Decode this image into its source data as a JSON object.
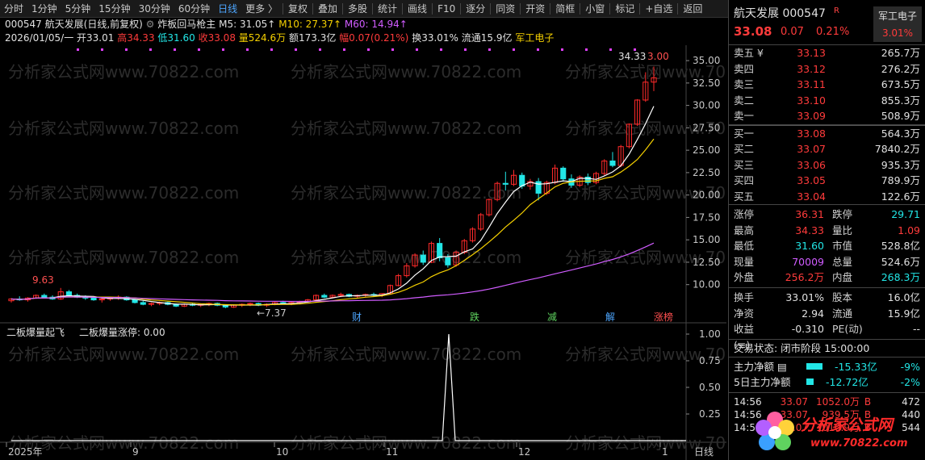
{
  "toolbar": {
    "periods": [
      "分时",
      "1分钟",
      "5分钟",
      "15分钟",
      "30分钟",
      "60分钟",
      "日线",
      "更多 〉"
    ],
    "active_period": "日线",
    "tools": [
      "复权",
      "叠加",
      "多股",
      "统计",
      "画线",
      "F10",
      "逐分",
      "同资",
      "开资",
      "简框",
      "小窗",
      "标记",
      "+自选",
      "返回"
    ]
  },
  "header": {
    "line1": {
      "code": "000547",
      "name": "航天发展",
      "mode": "(日线,前复权)",
      "indicator": "炸板回马枪主",
      "ma5": "M5: 31.05↑",
      "ma10": "M10: 27.37↑",
      "ma60": "M60: 14.94↑"
    },
    "line2": {
      "date_open": "2026/01/05/一 开33.01",
      "high": "高34.33",
      "low": "低31.60",
      "close": "收33.08",
      "vol": "量524.6万",
      "amount": "额173.3亿",
      "range": "幅0.07(0.21%)",
      "turnover": "换33.01%",
      "float": "流通15.9亿",
      "sector": "军工电子"
    }
  },
  "main_chart": {
    "y_ticks": [
      "35.00",
      "32.50",
      "30.00",
      "27.50",
      "25.00",
      "22.50",
      "20.00",
      "17.50",
      "15.00",
      "12.50",
      "10.00"
    ],
    "label_high": "9.63",
    "label_low": "←7.37",
    "label_top": "34.33",
    "label_top2": "3.00",
    "markers": [
      "财",
      "跌",
      "减",
      "解",
      "涨榜"
    ],
    "watermark": "分析家公式网www.70822.com"
  },
  "sub_chart": {
    "title": "二板爆量起飞",
    "value_label": "二板爆量涨停: 0.00",
    "y_ticks": [
      "1.00",
      "0.75",
      "0.50",
      "0.25"
    ]
  },
  "x_axis": {
    "labels": [
      "2025年",
      "9",
      "10",
      "11",
      "12",
      "1"
    ],
    "period": "日线"
  },
  "right": {
    "name": "航天发展",
    "code": "000547",
    "flag": "R",
    "price": "33.08",
    "change": "0.07",
    "pct": "0.21%",
    "sector": "军工电子",
    "sector_pct": "3.01%",
    "asks": [
      {
        "label": "卖五 ¥",
        "price": "33.13",
        "vol": "265.7万"
      },
      {
        "label": "卖四",
        "price": "33.12",
        "vol": "276.2万"
      },
      {
        "label": "卖三",
        "price": "33.11",
        "vol": "673.5万"
      },
      {
        "label": "卖二",
        "price": "33.10",
        "vol": "855.3万"
      },
      {
        "label": "卖一",
        "price": "33.09",
        "vol": "508.9万"
      }
    ],
    "bids": [
      {
        "label": "买一",
        "price": "33.08",
        "vol": "564.3万"
      },
      {
        "label": "买二",
        "price": "33.07",
        "vol": "7840.2万"
      },
      {
        "label": "买三",
        "price": "33.06",
        "vol": "935.3万"
      },
      {
        "label": "买四",
        "price": "33.05",
        "vol": "789.9万"
      },
      {
        "label": "买五",
        "price": "33.04",
        "vol": "122.6万"
      }
    ],
    "stats1": [
      {
        "l": "涨停",
        "v": "36.31",
        "c": "red",
        "l2": "跌停",
        "v2": "29.71",
        "c2": "cyan"
      },
      {
        "l": "最高",
        "v": "34.33",
        "c": "red",
        "l2": "量比",
        "v2": "1.09",
        "c2": "red"
      },
      {
        "l": "最低",
        "v": "31.60",
        "c": "cyan",
        "l2": "市值",
        "v2": "528.8亿",
        "c2": "white"
      },
      {
        "l": "现量",
        "v": "70009",
        "c": "purple",
        "l2": "总量",
        "v2": "524.6万",
        "c2": "white"
      },
      {
        "l": "外盘",
        "v": "256.2万",
        "c": "red",
        "l2": "内盘",
        "v2": "268.3万",
        "c2": "cyan"
      }
    ],
    "stats2": [
      {
        "l": "换手",
        "v": "33.01%",
        "c": "white",
        "l2": "股本",
        "v2": "16.0亿",
        "c2": "white"
      },
      {
        "l": "净资",
        "v": "2.94",
        "c": "white",
        "l2": "流通",
        "v2": "15.9亿",
        "c2": "white"
      },
      {
        "l": "收益(≡)",
        "v": "-0.310",
        "c": "white",
        "l2": "PE(动)",
        "v2": "--",
        "c2": "white"
      }
    ],
    "status": "交易状态: 闭市阶段 15:00:00",
    "flows": [
      {
        "label": "主力净额 ▤",
        "value": "-15.33亿",
        "pct": "-9%",
        "bar": 0.9
      },
      {
        "label": "5日主力净额",
        "value": "-12.72亿",
        "pct": "-2%",
        "bar": 0.4
      }
    ],
    "ticks": [
      {
        "t": "14:56",
        "p": "33.07",
        "v": "1052.0万",
        "s": "B",
        "n": "472"
      },
      {
        "t": "14:56",
        "p": "33.07",
        "v": "939.5万",
        "s": "B",
        "n": "440"
      },
      {
        "t": "14:56",
        "p": "33.07",
        "v": "1010.9万",
        "s": "B",
        "n": "544"
      }
    ],
    "logo": {
      "t1": "分析家公式网",
      "t2": "www.70822.com"
    }
  },
  "chart_data": {
    "type": "candlestick",
    "title": "航天发展 (日线,前复权)",
    "ylim": [
      7,
      36
    ],
    "x_labels": [
      "2025年",
      "9",
      "10",
      "11",
      "12",
      "1"
    ],
    "candles": [
      [
        8.2,
        8.5,
        8.0,
        8.4
      ],
      [
        8.4,
        8.7,
        8.2,
        8.3
      ],
      [
        8.3,
        8.6,
        8.1,
        8.5
      ],
      [
        8.5,
        8.9,
        8.4,
        8.8
      ],
      [
        8.8,
        9.0,
        8.5,
        8.6
      ],
      [
        8.6,
        8.8,
        8.3,
        8.4
      ],
      [
        8.4,
        9.63,
        8.3,
        9.2
      ],
      [
        9.2,
        9.4,
        8.7,
        8.8
      ],
      [
        8.8,
        9.0,
        8.5,
        8.6
      ],
      [
        8.6,
        8.8,
        8.3,
        8.5
      ],
      [
        8.5,
        8.7,
        8.2,
        8.3
      ],
      [
        8.3,
        8.5,
        8.0,
        8.4
      ],
      [
        8.4,
        8.6,
        8.2,
        8.5
      ],
      [
        8.5,
        8.8,
        8.3,
        8.6
      ],
      [
        8.6,
        8.7,
        8.2,
        8.3
      ],
      [
        8.3,
        8.4,
        7.9,
        8.0
      ],
      [
        8.0,
        8.2,
        7.7,
        7.8
      ],
      [
        7.8,
        8.0,
        7.6,
        7.9
      ],
      [
        7.9,
        8.1,
        7.7,
        8.0
      ],
      [
        8.0,
        8.1,
        7.7,
        7.8
      ],
      [
        7.8,
        7.9,
        7.5,
        7.6
      ],
      [
        7.6,
        7.9,
        7.5,
        7.8
      ],
      [
        7.8,
        8.0,
        7.6,
        7.7
      ],
      [
        7.7,
        7.9,
        7.5,
        7.8
      ],
      [
        7.8,
        8.0,
        7.6,
        7.9
      ],
      [
        7.9,
        8.0,
        7.6,
        7.7
      ],
      [
        7.7,
        7.8,
        7.37,
        7.5
      ],
      [
        7.5,
        7.8,
        7.4,
        7.7
      ],
      [
        7.7,
        7.9,
        7.5,
        7.8
      ],
      [
        7.8,
        8.0,
        7.6,
        7.9
      ],
      [
        7.9,
        8.0,
        7.6,
        7.7
      ],
      [
        7.7,
        7.9,
        7.5,
        7.8
      ],
      [
        7.8,
        8.1,
        7.7,
        8.0
      ],
      [
        8.0,
        8.2,
        7.8,
        7.9
      ],
      [
        7.9,
        8.1,
        7.7,
        8.0
      ],
      [
        8.0,
        8.2,
        7.8,
        8.1
      ],
      [
        8.1,
        8.4,
        8.0,
        8.3
      ],
      [
        8.3,
        8.9,
        8.2,
        8.8
      ],
      [
        8.8,
        9.0,
        8.5,
        8.6
      ],
      [
        8.6,
        8.9,
        8.5,
        8.8
      ],
      [
        8.8,
        9.1,
        8.6,
        8.9
      ],
      [
        8.9,
        9.0,
        8.6,
        8.7
      ],
      [
        8.7,
        8.9,
        8.5,
        8.8
      ],
      [
        8.8,
        9.0,
        8.6,
        8.9
      ],
      [
        8.9,
        9.1,
        8.7,
        8.8
      ],
      [
        8.8,
        9.0,
        8.6,
        9.0
      ],
      [
        9.0,
        10.0,
        8.9,
        9.9
      ],
      [
        9.9,
        11.2,
        9.8,
        11.0
      ],
      [
        11.0,
        12.4,
        10.8,
        12.1
      ],
      [
        12.1,
        13.5,
        11.9,
        13.3
      ],
      [
        13.3,
        13.8,
        12.2,
        12.5
      ],
      [
        12.5,
        14.8,
        12.4,
        14.6
      ],
      [
        14.6,
        15.2,
        12.6,
        13.0
      ],
      [
        13.0,
        13.4,
        11.9,
        12.2
      ],
      [
        12.2,
        13.8,
        12.0,
        13.6
      ],
      [
        13.6,
        15.1,
        13.4,
        14.9
      ],
      [
        14.9,
        16.4,
        14.7,
        16.2
      ],
      [
        16.2,
        18.0,
        16.0,
        17.8
      ],
      [
        17.8,
        19.6,
        17.6,
        19.5
      ],
      [
        19.5,
        21.5,
        19.3,
        21.3
      ],
      [
        21.3,
        22.6,
        20.5,
        21.2
      ],
      [
        21.2,
        22.8,
        21.0,
        22.2
      ],
      [
        22.2,
        22.5,
        20.7,
        21.0
      ],
      [
        21.0,
        21.8,
        20.6,
        21.5
      ],
      [
        21.5,
        21.9,
        19.4,
        20.2
      ],
      [
        20.2,
        21.6,
        20.0,
        21.4
      ],
      [
        21.4,
        23.4,
        21.2,
        23.0
      ],
      [
        23.0,
        23.2,
        21.5,
        21.8
      ],
      [
        21.8,
        22.3,
        20.8,
        21.1
      ],
      [
        21.1,
        22.2,
        20.9,
        22.0
      ],
      [
        22.0,
        22.4,
        21.1,
        21.4
      ],
      [
        21.4,
        22.6,
        21.2,
        22.4
      ],
      [
        22.4,
        24.0,
        22.2,
        23.8
      ],
      [
        23.8,
        24.8,
        23.1,
        23.3
      ],
      [
        23.3,
        25.6,
        23.1,
        25.4
      ],
      [
        25.4,
        28.0,
        25.2,
        27.9
      ],
      [
        27.9,
        30.7,
        27.7,
        30.6
      ],
      [
        30.6,
        33.7,
        30.4,
        32.6
      ],
      [
        32.6,
        34.33,
        31.6,
        33.08
      ]
    ],
    "ma5_last": 31.05,
    "ma10_last": 27.37,
    "ma60_last": 14.94,
    "indicator_spike": {
      "name": "二板爆量起飞",
      "peak": 1.0
    }
  }
}
